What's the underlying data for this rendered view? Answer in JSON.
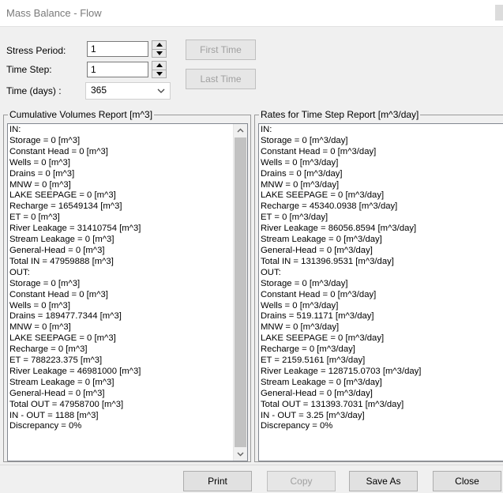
{
  "window": {
    "title": "Mass Balance - Flow"
  },
  "controls": {
    "stress_period_label": "Stress Period:",
    "stress_period_value": "1",
    "time_step_label": "Time Step:",
    "time_step_value": "1",
    "time_days_label": "Time (days) :",
    "time_days_value": "365",
    "first_time_label": "First Time",
    "last_time_label": "Last Time"
  },
  "cumulative": {
    "title": "Cumulative Volumes Report [m^3]",
    "lines": [
      "IN:",
      "Storage = 0 [m^3]",
      "Constant Head =  0 [m^3]",
      "Wells = 0 [m^3]",
      "Drains =  0 [m^3]",
      "MNW = 0 [m^3]",
      "LAKE  SEEPAGE = 0 [m^3]",
      "Recharge =  16549134 [m^3]",
      "ET = 0 [m^3]",
      "River Leakage = 31410754 [m^3]",
      "Stream Leakage = 0 [m^3]",
      "General-Head = 0 [m^3]",
      "Total IN =  47959888 [m^3]",
      "OUT:",
      "Storage = 0 [m^3]",
      "Constant Head =  0 [m^3]",
      "Wells = 0 [m^3]",
      "Drains =  189477.7344 [m^3]",
      "MNW = 0 [m^3]",
      "LAKE  SEEPAGE = 0 [m^3]",
      "Recharge =  0 [m^3]",
      "ET = 788223.375 [m^3]",
      "River Leakage = 46981000 [m^3]",
      "Stream Leakage = 0 [m^3]",
      "General-Head = 0 [m^3]",
      "Total OUT =  47958700 [m^3]",
      "IN - OUT = 1188 [m^3]",
      "Discrepancy = 0%"
    ]
  },
  "rates": {
    "title": "Rates for Time Step Report [m^3/day]",
    "lines": [
      "IN:",
      "Storage = 0 [m^3/day]",
      "Constant Head =  0 [m^3/day]",
      "Wells = 0 [m^3/day]",
      "Drains =  0 [m^3/day]",
      "MNW = 0 [m^3/day]",
      "LAKE  SEEPAGE = 0 [m^3/day]",
      "Recharge =  45340.0938 [m^3/day]",
      "ET = 0 [m^3/day]",
      "River Leakage = 86056.8594 [m^3/day]",
      "Stream Leakage = 0 [m^3/day]",
      "General-Head = 0 [m^3/day]",
      "Total IN =  131396.9531 [m^3/day]",
      "OUT:",
      "Storage = 0 [m^3/day]",
      "Constant Head =  0 [m^3/day]",
      "Wells = 0 [m^3/day]",
      "Drains =  519.1171 [m^3/day]",
      "MNW = 0 [m^3/day]",
      "LAKE  SEEPAGE = 0 [m^3/day]",
      "Recharge =  0 [m^3/day]",
      "ET = 2159.5161 [m^3/day]",
      "River Leakage = 128715.0703 [m^3/day]",
      "Stream Leakage = 0 [m^3/day]",
      "General-Head = 0 [m^3/day]",
      "Total OUT =  131393.7031 [m^3/day]",
      "IN - OUT = 3.25 [m^3/day]",
      "Discrepancy = 0%"
    ]
  },
  "buttons": {
    "print": "Print",
    "copy": "Copy",
    "save_as": "Save As",
    "close": "Close"
  }
}
